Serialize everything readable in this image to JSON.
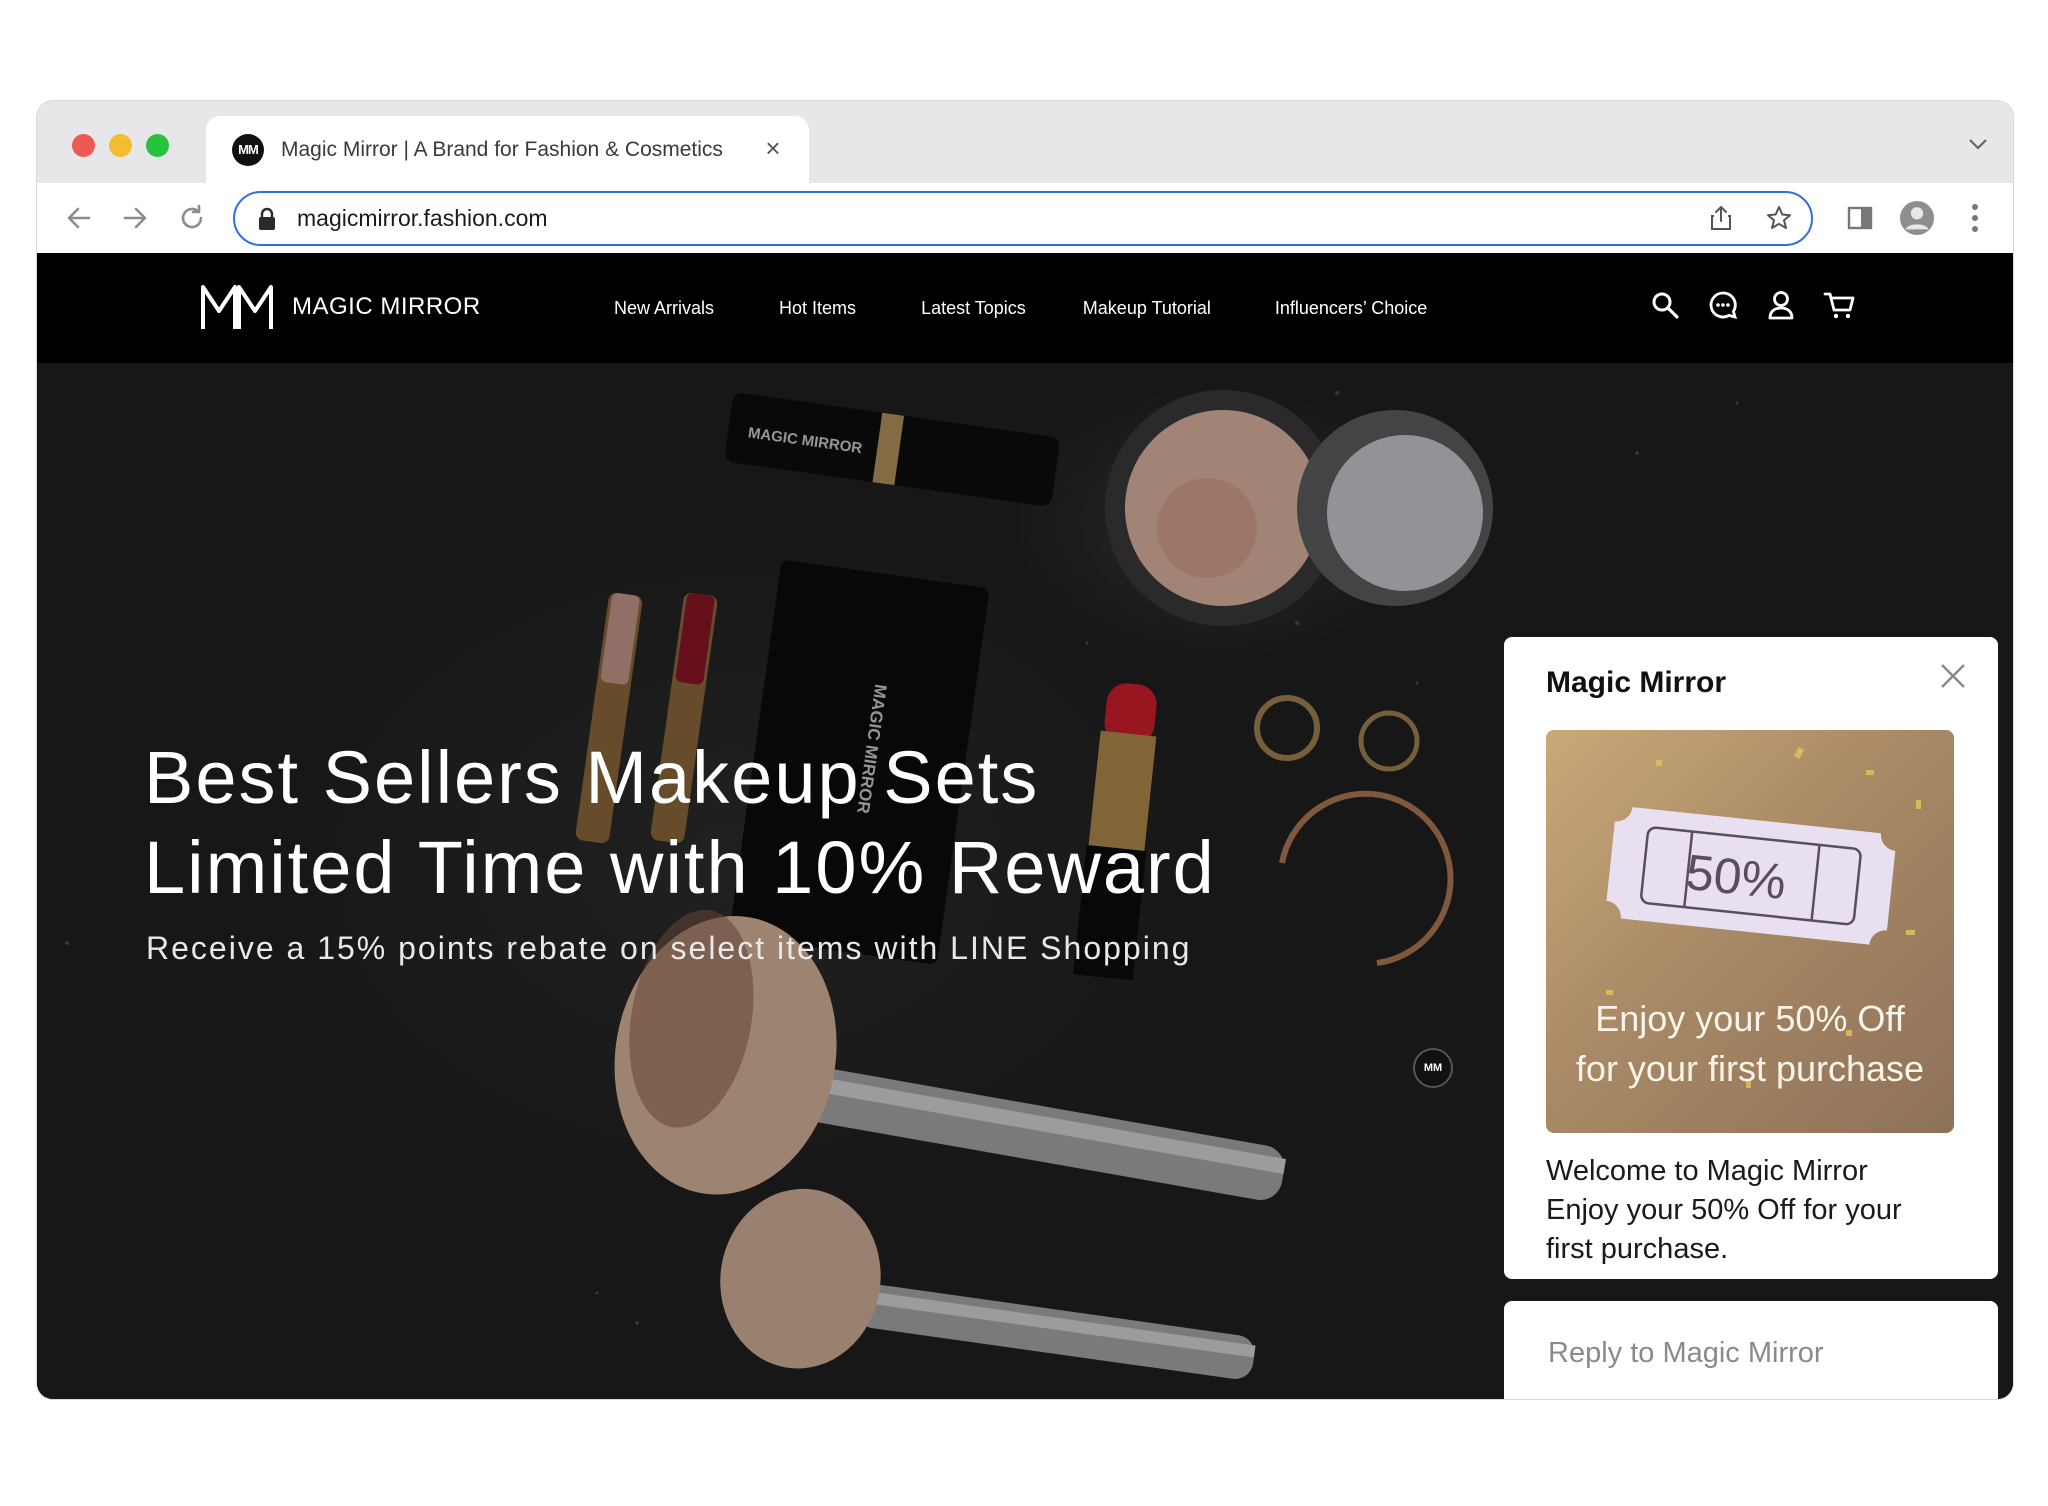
{
  "browser": {
    "tab_title": "Magic Mirror | A Brand for Fashion & Cosmetics",
    "tab_favicon": "MM",
    "url": "magicmirror.fashion.com"
  },
  "site": {
    "logo_text": "MAGIC MIRROR",
    "menu": [
      {
        "label": "New Arrivals"
      },
      {
        "label": "Hot Items"
      },
      {
        "label": "Latest Topics"
      },
      {
        "label": "Makeup Tutorial"
      },
      {
        "label": "Influencers’ Choice"
      }
    ],
    "icons": [
      "search-icon",
      "chat-icon",
      "user-icon",
      "cart-icon"
    ]
  },
  "hero": {
    "title_line1": "Best Sellers Makeup Sets",
    "title_line2": "Limited Time with 10% Reward",
    "subtitle": "Receive a 15% points rebate on select items with LINE Shopping",
    "product_label": "MAGIC MIRROR"
  },
  "chat": {
    "title": "Magic Mirror",
    "promo_badge": "50%",
    "promo_line1": "Enjoy your 50% Off",
    "promo_line2": "for your first purchase",
    "message_line1": "Welcome to Magic Mirror",
    "message_line2": "Enjoy your 50% Off for your",
    "message_line3": "first purchase.",
    "avatar_text": "MM",
    "reply_placeholder": "Reply to Magic Mirror"
  },
  "colors": {
    "accent_border": "#2f6fe0",
    "nav_bg": "#000000",
    "promo_gold": "#b8996f"
  }
}
